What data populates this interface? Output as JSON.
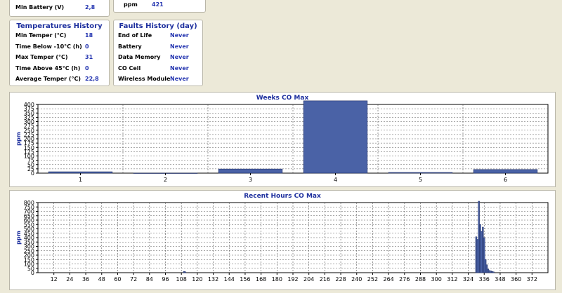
{
  "top_left": {
    "label": "Min Battery (V)",
    "value": "2,8"
  },
  "top_mid": {
    "label": "ppm",
    "value": "421"
  },
  "temps": {
    "title": "Temperatures History",
    "rows": [
      {
        "label": "Min Temper (°C)",
        "value": "18"
      },
      {
        "label": "Time Below -10°C (h)",
        "value": "0"
      },
      {
        "label": "Max Temper (°C)",
        "value": "31"
      },
      {
        "label": "Time Above 45°C (h)",
        "value": "0"
      },
      {
        "label": "Average Temper (°C)",
        "value": "22,8"
      }
    ]
  },
  "faults": {
    "title": "Faults History (day)",
    "rows": [
      {
        "label": "End of Life",
        "value": "Never"
      },
      {
        "label": "Battery",
        "value": "Never"
      },
      {
        "label": "Data Memory",
        "value": "Never"
      },
      {
        "label": "CO Cell",
        "value": "Never"
      },
      {
        "label": "Wireless Module",
        "value": "Never"
      }
    ]
  },
  "colors": {
    "bar": "#4a62a6",
    "bar_dark": "#1e2d64",
    "title": "#1d2f9e"
  },
  "chart_data": [
    {
      "type": "bar",
      "title": "Weeks CO Max",
      "ylabel": "ppm",
      "ylim": [
        0,
        400
      ],
      "yticks": [
        0,
        25,
        50,
        75,
        100,
        125,
        150,
        175,
        200,
        225,
        250,
        275,
        300,
        325,
        350,
        375,
        400
      ],
      "categories": [
        "1",
        "2",
        "3",
        "4",
        "5",
        "6"
      ],
      "values": [
        8,
        0,
        24,
        421,
        4,
        21
      ],
      "grid": true
    },
    {
      "type": "bar",
      "title": "Recent Hours CO Max",
      "ylabel": "ppm",
      "ylim": [
        0,
        800
      ],
      "yticks": [
        0,
        50,
        100,
        150,
        200,
        250,
        300,
        350,
        400,
        450,
        500,
        550,
        600,
        650,
        700,
        750,
        800
      ],
      "xlim": [
        0,
        384
      ],
      "xticks": [
        12,
        24,
        36,
        48,
        60,
        72,
        84,
        96,
        108,
        120,
        132,
        144,
        156,
        168,
        180,
        192,
        204,
        216,
        228,
        240,
        252,
        264,
        276,
        288,
        300,
        312,
        324,
        336,
        348,
        360,
        372
      ],
      "points": [
        {
          "x": 110,
          "y": 15
        },
        {
          "x": 111,
          "y": 10
        },
        {
          "x": 330,
          "y": 410
        },
        {
          "x": 331,
          "y": 380
        },
        {
          "x": 332,
          "y": 820
        },
        {
          "x": 333,
          "y": 550
        },
        {
          "x": 334,
          "y": 470
        },
        {
          "x": 335,
          "y": 520
        },
        {
          "x": 336,
          "y": 400
        },
        {
          "x": 337,
          "y": 150
        },
        {
          "x": 338,
          "y": 90
        },
        {
          "x": 339,
          "y": 40
        },
        {
          "x": 340,
          "y": 25
        },
        {
          "x": 341,
          "y": 20
        },
        {
          "x": 342,
          "y": 15
        },
        {
          "x": 343,
          "y": 10
        }
      ],
      "grid": true
    }
  ]
}
